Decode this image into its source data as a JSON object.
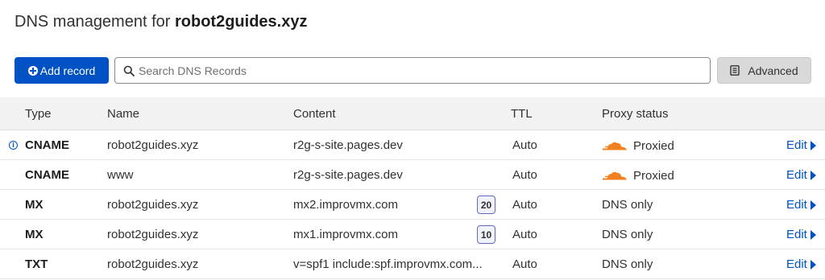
{
  "header": {
    "title_prefix": "DNS management for ",
    "domain": "robot2guides.xyz"
  },
  "toolbar": {
    "add_label": "Add record",
    "search_placeholder": "Search DNS Records",
    "advanced_label": "Advanced"
  },
  "columns": [
    "Type",
    "Name",
    "Content",
    "TTL",
    "Proxy status"
  ],
  "records": [
    {
      "type": "CNAME",
      "name": "robot2guides.xyz",
      "content": "r2g-s-site.pages.dev",
      "priority": "",
      "ttl": "Auto",
      "proxy": "Proxied",
      "edit": "Edit"
    },
    {
      "type": "CNAME",
      "name": "www",
      "content": "r2g-s-site.pages.dev",
      "priority": "",
      "ttl": "Auto",
      "proxy": "Proxied",
      "edit": "Edit"
    },
    {
      "type": "MX",
      "name": "robot2guides.xyz",
      "content": "mx2.improvmx.com",
      "priority": "20",
      "ttl": "Auto",
      "proxy": "DNS only",
      "edit": "Edit"
    },
    {
      "type": "MX",
      "name": "robot2guides.xyz",
      "content": "mx1.improvmx.com",
      "priority": "10",
      "ttl": "Auto",
      "proxy": "DNS only",
      "edit": "Edit"
    },
    {
      "type": "TXT",
      "name": "robot2guides.xyz",
      "content": "v=spf1 include:spf.improvmx.com...",
      "priority": "",
      "ttl": "Auto",
      "proxy": "DNS only",
      "edit": "Edit"
    }
  ],
  "icons": {
    "add": "plus-circle-icon",
    "search": "search-icon",
    "advanced": "document-icon",
    "info": "info-icon",
    "proxied": "orange-cloud-icon",
    "edit": "caret-right-icon"
  },
  "colors": {
    "primary": "#0051c3",
    "cloud": "#f38020",
    "header_bg": "#f2f2f2"
  }
}
